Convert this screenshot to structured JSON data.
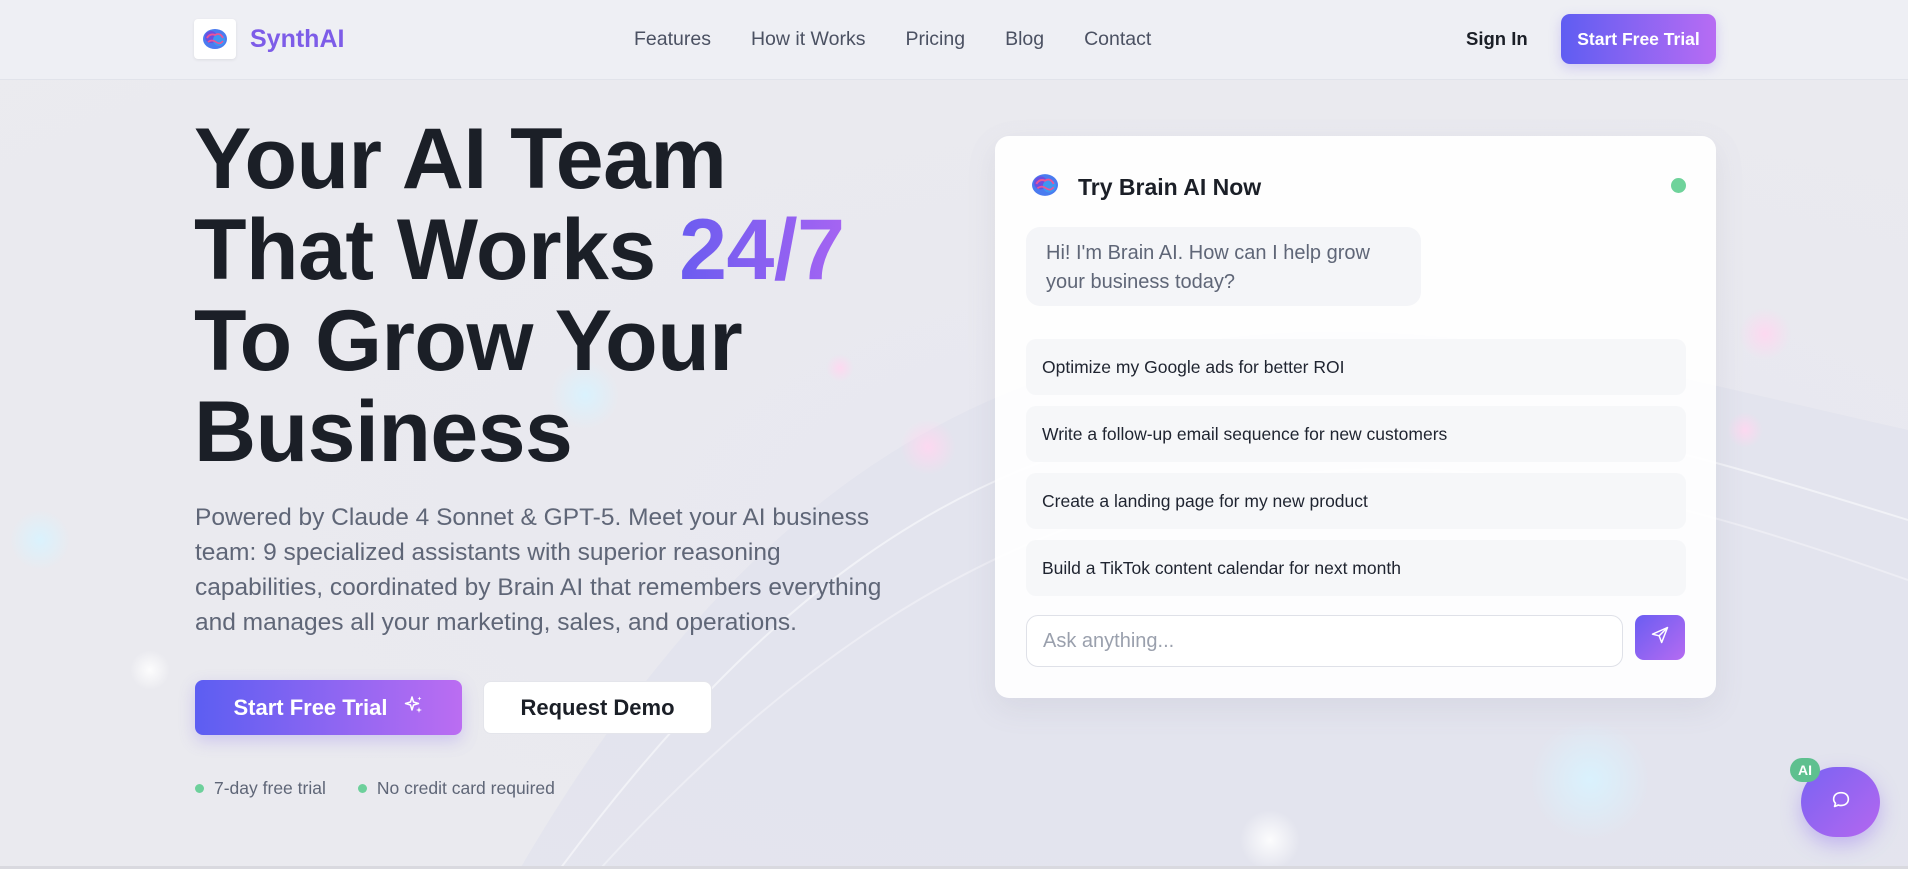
{
  "nav": {
    "brand": "SynthAI",
    "links": [
      "Features",
      "How it Works",
      "Pricing",
      "Blog",
      "Contact"
    ],
    "sign_in": "Sign In",
    "cta": "Start Free Trial"
  },
  "hero": {
    "title_line1": "Your AI Team",
    "title_line2_pre": "That Works ",
    "title_line2_accent": "24/7",
    "title_line3": "To Grow Your",
    "title_line4": "Business",
    "subtitle": "Powered by Claude 4 Sonnet & GPT-5. Meet your AI business team: 9 specialized assistants with superior reasoning capabilities, coordinated by Brain AI that remembers everything and manages all your marketing, sales, and operations.",
    "primary_button": "Start Free Trial",
    "secondary_button": "Request Demo",
    "perks": [
      "7-day free trial",
      "No credit card required"
    ]
  },
  "chat": {
    "title": "Try Brain AI Now",
    "greeting": "Hi! I'm Brain AI. How can I help grow your business today?",
    "suggestions": [
      "Optimize my Google ads for better ROI",
      "Write a follow-up email sequence for new customers",
      "Create a landing page for my new product",
      "Build a TikTok content calendar for next month"
    ],
    "input_placeholder": "Ask anything...",
    "input_value": ""
  },
  "widget": {
    "badge": "AI"
  },
  "icons": {
    "brand": "brain-icon",
    "chat_header": "brain-icon",
    "primary_button": "sparkles-icon",
    "send": "send-icon",
    "widget": "chat-bubble-icon"
  },
  "colors": {
    "brand": "#7d5ce8",
    "gradient_start": "#5f5df2",
    "gradient_end": "#b76cf3",
    "status_green": "#6fd39b",
    "text_dark": "#1b1f27",
    "text_muted": "#5f6677"
  }
}
